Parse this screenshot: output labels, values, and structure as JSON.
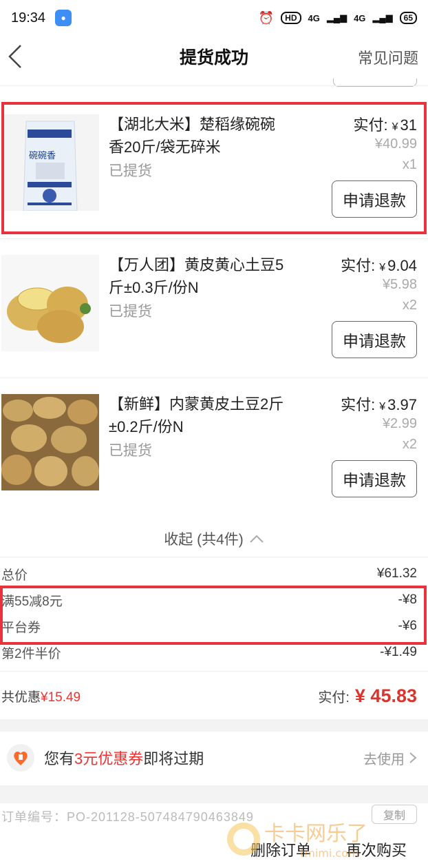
{
  "status_bar": {
    "time": "19:34",
    "hd": "HD",
    "net1": "4G",
    "net2": "4G",
    "battery": "65"
  },
  "header": {
    "title": "提货成功",
    "faq": "常见问题"
  },
  "items": [
    {
      "name": "【湖北大米】楚稻缘碗碗香20斤/袋无碎米",
      "status": "已提货",
      "paid_label": "实付:",
      "currency": "¥",
      "paid": "31",
      "orig": "¥40.99",
      "qty": "x1",
      "refund": "申请退款",
      "thumb_text": "碗碗香"
    },
    {
      "name": "【万人团】黄皮黄心土豆5斤±0.3斤/份N",
      "status": "已提货",
      "paid_label": "实付:",
      "currency": "¥",
      "paid": "9.04",
      "orig": "¥5.98",
      "qty": "x2",
      "refund": "申请退款"
    },
    {
      "name": "【新鲜】内蒙黄皮土豆2斤±0.2斤/份N",
      "status": "已提货",
      "paid_label": "实付:",
      "currency": "¥",
      "paid": "3.97",
      "orig": "¥2.99",
      "qty": "x2",
      "refund": "申请退款"
    }
  ],
  "collapse_label": "收起 (共4件)",
  "summary": [
    {
      "label": "总价",
      "value": "¥61.32"
    },
    {
      "label": "满55减8元",
      "value": "-¥8"
    },
    {
      "label": "平台券",
      "value": "-¥6"
    },
    {
      "label": "第2件半价",
      "value": "-¥1.49"
    }
  ],
  "totals": {
    "saved_label": "共优惠",
    "saved_value": "¥15.49",
    "final_label": "实付:",
    "final_value": "¥ 45.83"
  },
  "coupon": {
    "prefix": "您有",
    "highlight": "3元优惠券",
    "suffix": "即将过期",
    "action": "去使用"
  },
  "bottom": {
    "order_no": "订单编号：PO-201128-507484790463849",
    "copy": "复制",
    "delete": "删除订单",
    "rebuy": "再次购买"
  },
  "watermark": {
    "text": "卡卡网乐了",
    "url": "tmimi.com"
  },
  "colors": {
    "accent_red": "#e33",
    "highlight_border": "#e8323c",
    "price_red": "#d9352f"
  }
}
